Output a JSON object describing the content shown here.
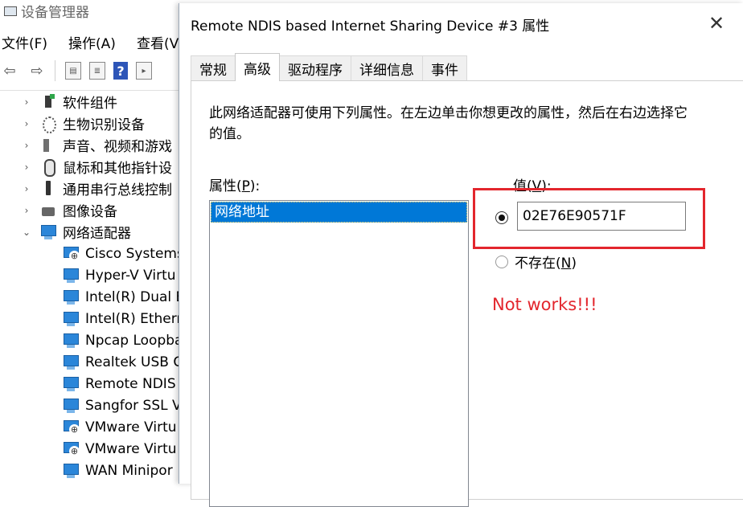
{
  "device_manager": {
    "title": "设备管理器",
    "menu": [
      "文件(F)",
      "操作(A)",
      "查看(V)"
    ],
    "categories": [
      {
        "label": "软件组件",
        "icon": "chip-icon"
      },
      {
        "label": "生物识别设备",
        "icon": "fingerprint-icon"
      },
      {
        "label": "声音、视频和游戏",
        "icon": "speaker-icon"
      },
      {
        "label": "鼠标和其他指针设",
        "icon": "mouse-icon"
      },
      {
        "label": "通用串行总线控制",
        "icon": "usb-icon"
      },
      {
        "label": "图像设备",
        "icon": "camera-icon"
      },
      {
        "label": "网络适配器",
        "icon": "network-adapter-icon",
        "expanded": true
      }
    ],
    "adapters": [
      "Cisco Systems",
      "Hyper-V Virtu",
      "Intel(R) Dual E",
      "Intel(R) Etherr",
      "Npcap Loopba",
      "Realtek USB G",
      "Remote NDIS",
      "Sangfor SSL V",
      "VMware Virtu",
      "VMware Virtu",
      "WAN Minipor"
    ]
  },
  "dialog": {
    "title": "Remote NDIS based Internet Sharing Device #3 属性",
    "tabs": [
      "常规",
      "高级",
      "驱动程序",
      "详细信息",
      "事件"
    ],
    "active_tab": "高级",
    "description": "此网络适配器可使用下列属性。在左边单击你想更改的属性，然后在右边选择它的值。",
    "property_label_prefix": "属性(",
    "property_label_key": "P",
    "property_label_suffix": "):",
    "properties": [
      "网络地址"
    ],
    "value_label_prefix": "值(",
    "value_label_key": "V",
    "value_label_suffix": "):",
    "value": "02E76E90571F",
    "not_present_prefix": "不存在(",
    "not_present_key": "N",
    "not_present_suffix": ")",
    "annotation": "Not works!!!",
    "highlight_color": "#e3262d"
  }
}
